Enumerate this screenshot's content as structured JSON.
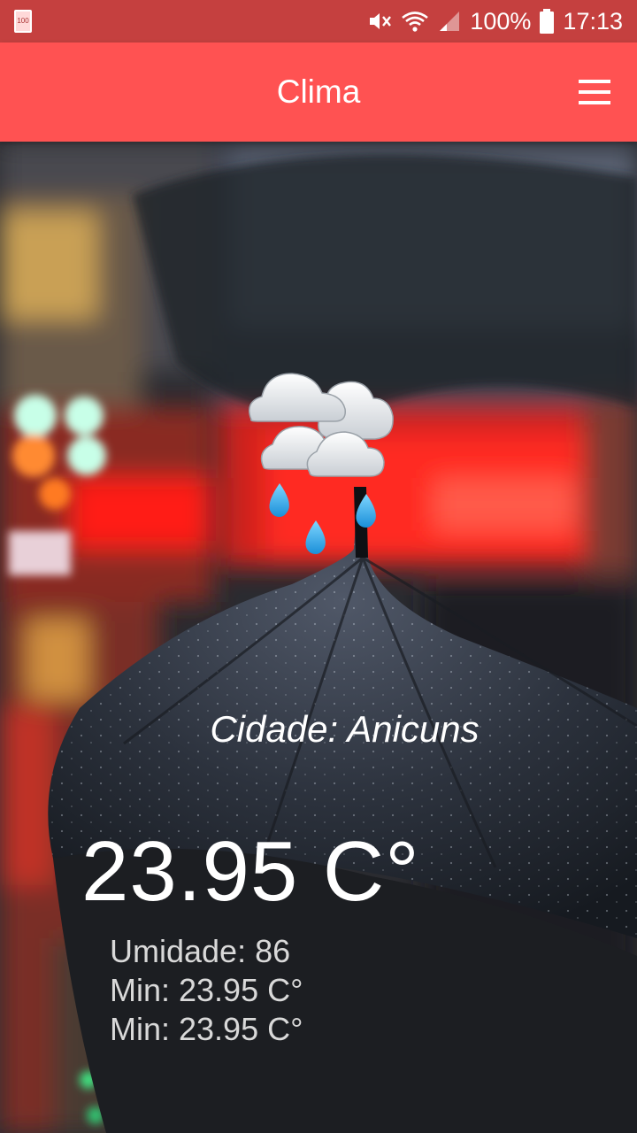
{
  "status_bar": {
    "left_icon_label": "100",
    "battery_percent": "100%",
    "time": "17:13",
    "icons": [
      "mute-icon",
      "wifi-icon",
      "signal-icon",
      "battery-icon"
    ]
  },
  "app_bar": {
    "title": "Clima",
    "menu_icon": "hamburger-menu-icon",
    "color": "#ff5252"
  },
  "weather": {
    "icon": "rain-cloud-icon",
    "city_label": "Cidade: Anicuns",
    "temperature": "23.95 C°",
    "humidity": "Umidade: 86",
    "min": "Min: 23.95 C°",
    "min_repeat": "Min: 23.95 C°"
  },
  "colors": {
    "status_bar": "#c5403f",
    "app_bar": "#ff5252",
    "text_primary": "#ffffff",
    "text_secondary": "#d9d9d9"
  }
}
